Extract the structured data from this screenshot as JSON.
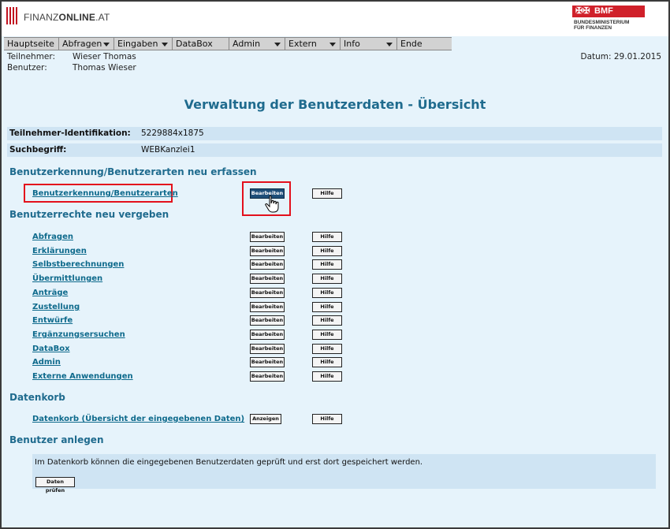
{
  "header": {
    "logo_text_light": "FINANZ",
    "logo_text_bold": "ONLINE",
    "logo_text_suffix": ".AT",
    "bmf_abbr": "BMF",
    "bmf_line1": "BUNDESMINISTERIUM",
    "bmf_line2": "FÜR FINANZEN"
  },
  "menu": {
    "hauptseite": "Hauptseite",
    "abfragen": "Abfragen",
    "eingaben": "Eingaben",
    "databox": "DataBox",
    "admin": "Admin",
    "extern": "Extern",
    "info": "Info",
    "ende": "Ende"
  },
  "user": {
    "teilnehmer_label": "Teilnehmer:",
    "teilnehmer_value": "Wieser Thomas",
    "benutzer_label": "Benutzer:",
    "benutzer_value": "Thomas Wieser",
    "date": "Datum: 29.01.2015"
  },
  "title": "Verwaltung der Benutzerdaten - Übersicht",
  "info": {
    "id_label": "Teilnehmer-Identifikation:",
    "id_value": "5229884x1875",
    "search_label": "Suchbegriff:",
    "search_value": "WEBKanzlei1"
  },
  "section1": {
    "title": "Benutzerkennung/Benutzerarten neu erfassen",
    "link": "Benutzerkennung/Benutzerarten",
    "edit": "Bearbeiten",
    "help": "Hilfe"
  },
  "section2": {
    "title": "Benutzerrechte neu vergeben",
    "edit": "Bearbeiten",
    "help": "Hilfe",
    "items": [
      "Abfragen",
      "Erklärungen",
      "Selbstberechnungen",
      "Übermittlungen",
      "Anträge",
      "Zustellung",
      "Entwürfe",
      "Ergänzungsersuchen",
      "DataBox",
      "Admin",
      "Externe Anwendungen"
    ]
  },
  "section3": {
    "title": "Datenkorb",
    "link": "Datenkorb (Übersicht der eingegebenen Daten)",
    "show": "Anzeigen",
    "help": "Hilfe"
  },
  "section4": {
    "title": "Benutzer anlegen",
    "note": "Im Datenkorb können die eingegebenen Benutzerdaten geprüft und erst dort gespeichert werden.",
    "check": "Daten prüfen"
  }
}
